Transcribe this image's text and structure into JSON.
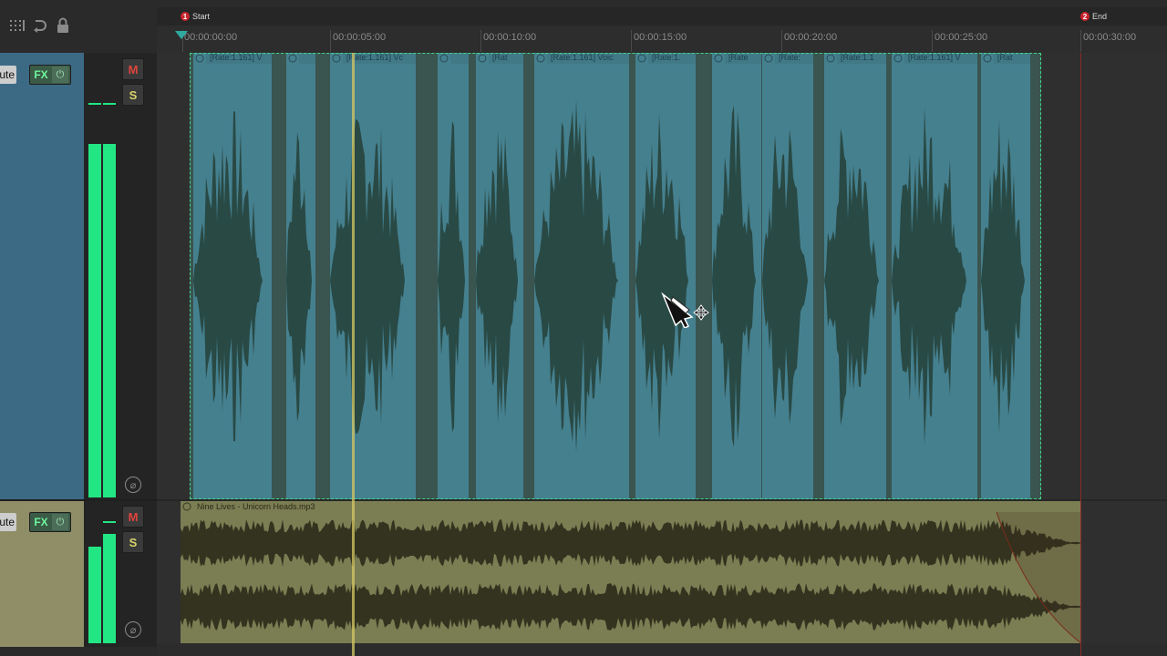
{
  "markers": [
    {
      "num": "1",
      "label": "Start"
    },
    {
      "num": "2",
      "label": "End"
    }
  ],
  "ruler": {
    "labels": [
      "00:00:00:00",
      "00:00:05:00",
      "00:00:10:00",
      "00:00:15:00",
      "00:00:20:00",
      "00:00:25:00",
      "00:00:30:00"
    ]
  },
  "track1": {
    "mute_fragment": "ute",
    "fx_label": "FX",
    "mute_label": "M",
    "solo_label": "S",
    "phase_label": "⌀",
    "colors": {
      "panel": "#3c6a85",
      "item": "#45808f",
      "wave": "#294944"
    },
    "items": [
      "[Rate:1.161] V",
      "",
      "[Rate:1.161] Vc",
      "",
      "[Rat",
      "[Rate:1.161] Voic",
      "[Rate:1.",
      "[Rate",
      "[Rate:",
      "[Rate:1.1",
      "[Rate:1.161] V",
      "[Rat"
    ]
  },
  "track2": {
    "mute_fragment": "ute",
    "fx_label": "FX",
    "mute_label": "M",
    "solo_label": "S",
    "phase_label": "⌀",
    "item_name": "Nine Lives - Unicorn Heads.mp3",
    "colors": {
      "panel": "#8f8e67",
      "item": "#7b7d53",
      "wave": "#34331f"
    }
  },
  "icons": [
    "grid-icon",
    "loop-icon",
    "lock-icon",
    "marker-start-icon",
    "marker-end-icon",
    "item-lock-icon",
    "item-fx-icon",
    "mouse-cursor-icon",
    "move-cursor-icon"
  ]
}
